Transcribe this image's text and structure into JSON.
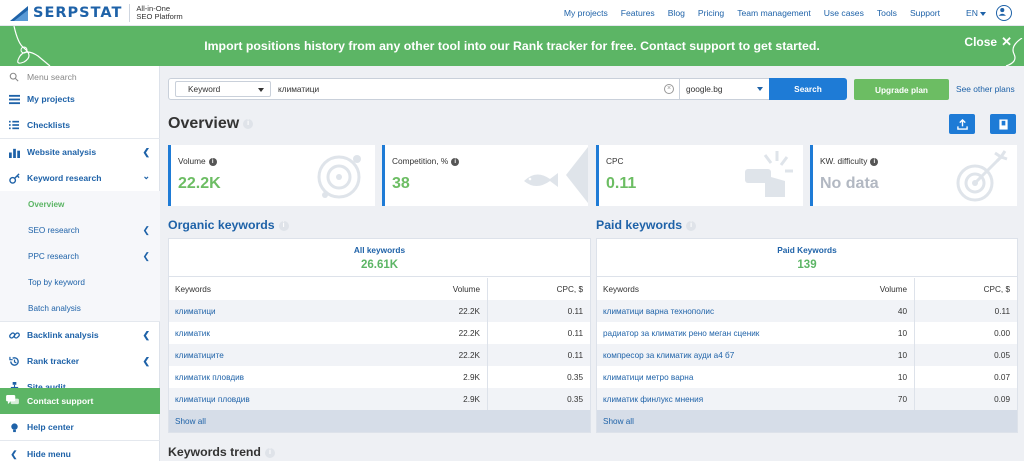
{
  "app": {
    "logo_text": "SERPSTAT",
    "tagline_1": "All-in-One",
    "tagline_2": "SEO Platform",
    "brand_color": "#1e62a8",
    "accent_green": "#5cb565"
  },
  "topnav": {
    "links": [
      "My projects",
      "Features",
      "Blog",
      "Pricing",
      "Team management",
      "Use cases",
      "Tools",
      "Support"
    ],
    "language": "EN"
  },
  "banner": {
    "text": "Import positions history from any other tool into our Rank tracker for free. Contact support to get started.",
    "close_label": "Close",
    "close_x": "✕"
  },
  "sidebar": {
    "search_placeholder": "Menu search",
    "my_projects": "My projects",
    "checklists": "Checklists",
    "website_analysis": "Website analysis",
    "keyword_research": "Keyword research",
    "overview": "Overview",
    "seo_research": "SEO research",
    "ppc_research": "PPC research",
    "top_by_keyword": "Top by keyword",
    "batch_analysis": "Batch analysis",
    "backlink_analysis": "Backlink analysis",
    "rank_tracker": "Rank tracker",
    "site_audit": "Site audit",
    "contact_support": "Contact support",
    "help_center": "Help center",
    "hide_menu": "Hide menu"
  },
  "search": {
    "type": "Keyword",
    "query": "климатици",
    "database": "google.bg",
    "search_label": "Search",
    "upgrade_label": "Upgrade plan",
    "see_plans": "See other plans"
  },
  "overview": {
    "title": "Overview",
    "info": "i",
    "cards": [
      {
        "label": "Volume",
        "value": "22.2K"
      },
      {
        "label": "Competition, %",
        "value": "38"
      },
      {
        "label": "CPC",
        "value": "0.11"
      },
      {
        "label": "KW. difficulty",
        "value": "No data"
      }
    ]
  },
  "organic": {
    "title": "Organic keywords",
    "summary_label": "All keywords",
    "summary_value": "26.61K",
    "columns": [
      "Keywords",
      "Volume",
      "CPC, $"
    ],
    "rows": [
      [
        "климатици",
        "22.2K",
        "0.11"
      ],
      [
        "климатик",
        "22.2K",
        "0.11"
      ],
      [
        "климатиците",
        "22.2K",
        "0.11"
      ],
      [
        "климатик пловдив",
        "2.9K",
        "0.35"
      ],
      [
        "климатици пловдив",
        "2.9K",
        "0.35"
      ]
    ],
    "show_all": "Show all"
  },
  "paid": {
    "title": "Paid keywords",
    "summary_label": "Paid Keywords",
    "summary_value": "139",
    "columns": [
      "Keywords",
      "Volume",
      "CPC, $"
    ],
    "rows": [
      [
        "климатици варна технополис",
        "40",
        "0.11"
      ],
      [
        "радиатор за климатик рено меган сценик",
        "10",
        "0.00"
      ],
      [
        "компресор за климатик ауди а4 б7",
        "10",
        "0.05"
      ],
      [
        "климатици метро варна",
        "10",
        "0.07"
      ],
      [
        "климатик финлукс мнения",
        "70",
        "0.09"
      ]
    ],
    "show_all": "Show all"
  },
  "trend": {
    "title": "Keywords trend"
  }
}
